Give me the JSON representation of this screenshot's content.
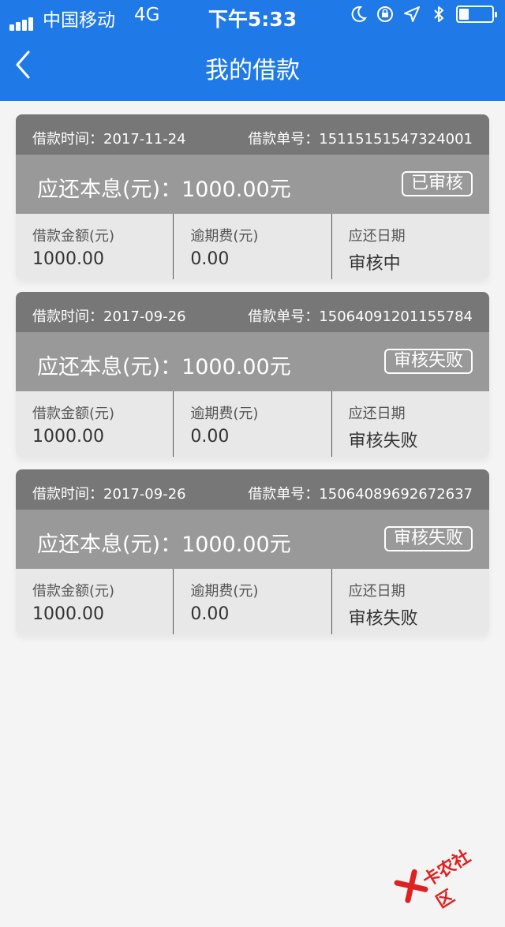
{
  "status_bar": {
    "carrier": "中国移动",
    "network": "4G",
    "time": "下午5:33"
  },
  "header": {
    "title": "我的借款",
    "back_icon": "chevron-left-icon"
  },
  "loans": [
    {
      "date_label": "借款时间：2017-11-24",
      "order_label": "借款单号：15115151547324001",
      "amount_label": "应还本息(元)：1000.00元",
      "status": "已审核",
      "principal_label": "借款金额(元)",
      "principal": "1000.00",
      "overdue_label": "逾期费(元)",
      "overdue": "0.00",
      "due_label": "应还日期",
      "due": "审核中"
    },
    {
      "date_label": "借款时间：2017-09-26",
      "order_label": "借款单号：15064091201155784",
      "amount_label": "应还本息(元)：1000.00元",
      "status": "审核失败",
      "principal_label": "借款金额(元)",
      "principal": "1000.00",
      "overdue_label": "逾期费(元)",
      "overdue": "0.00",
      "due_label": "应还日期",
      "due": "审核失败"
    },
    {
      "date_label": "借款时间：2017-09-26",
      "order_label": "借款单号：15064089692672637",
      "amount_label": "应还本息(元)：1000.00元",
      "status": "审核失败",
      "principal_label": "借款金额(元)",
      "principal": "1000.00",
      "overdue_label": "逾期费(元)",
      "overdue": "0.00",
      "due_label": "应还日期",
      "due": "审核失败"
    }
  ],
  "watermark": {
    "text": "卡农社区"
  },
  "colors": {
    "header_bg": "#1f7ae8",
    "card_head_bg": "#777777",
    "card_mid_bg": "#999999",
    "card_foot_bg": "#e8e8e8"
  }
}
